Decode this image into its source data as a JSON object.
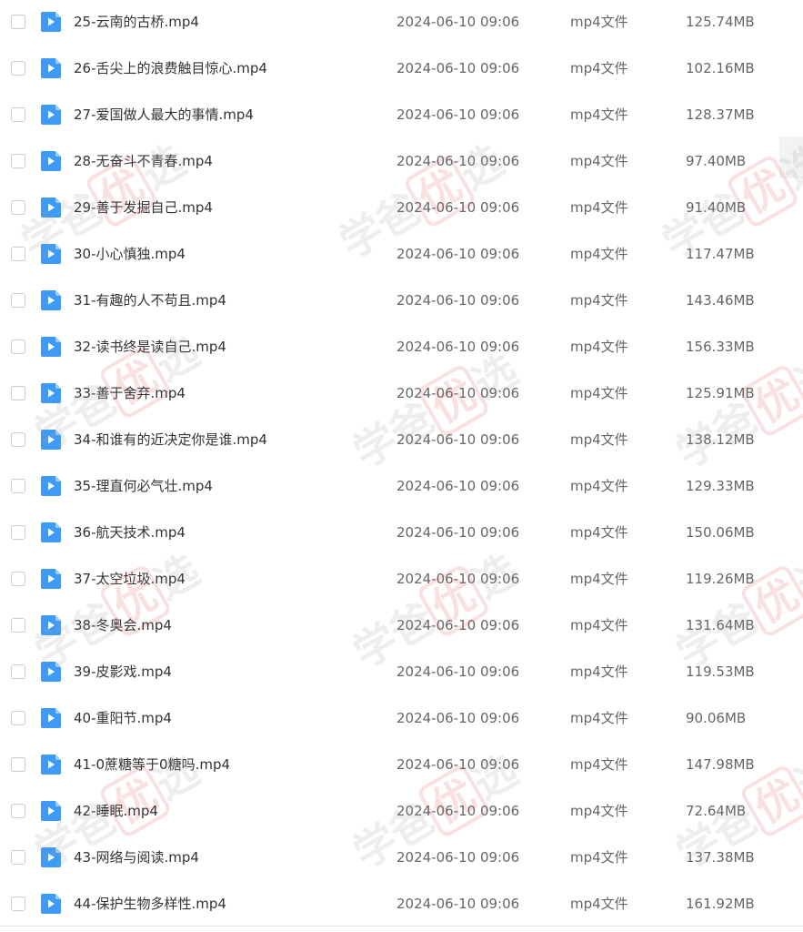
{
  "files": [
    {
      "name": "25-云南的古桥.mp4",
      "date": "2024-06-10 09:06",
      "type": "mp4文件",
      "size": "125.74MB"
    },
    {
      "name": "26-舌尖上的浪费触目惊心.mp4",
      "date": "2024-06-10 09:06",
      "type": "mp4文件",
      "size": "102.16MB"
    },
    {
      "name": "27-爱国做人最大的事情.mp4",
      "date": "2024-06-10 09:06",
      "type": "mp4文件",
      "size": "128.37MB"
    },
    {
      "name": "28-无奋斗不青春.mp4",
      "date": "2024-06-10 09:06",
      "type": "mp4文件",
      "size": "97.40MB"
    },
    {
      "name": "29-善于发掘自己.mp4",
      "date": "2024-06-10 09:06",
      "type": "mp4文件",
      "size": "91.40MB"
    },
    {
      "name": "30-小心慎独.mp4",
      "date": "2024-06-10 09:06",
      "type": "mp4文件",
      "size": "117.47MB"
    },
    {
      "name": "31-有趣的人不苟且.mp4",
      "date": "2024-06-10 09:06",
      "type": "mp4文件",
      "size": "143.46MB"
    },
    {
      "name": "32-读书终是读自己.mp4",
      "date": "2024-06-10 09:06",
      "type": "mp4文件",
      "size": "156.33MB"
    },
    {
      "name": "33-善于舍弃.mp4",
      "date": "2024-06-10 09:06",
      "type": "mp4文件",
      "size": "125.91MB"
    },
    {
      "name": "34-和谁有的近决定你是谁.mp4",
      "date": "2024-06-10 09:06",
      "type": "mp4文件",
      "size": "138.12MB"
    },
    {
      "name": "35-理直何必气壮.mp4",
      "date": "2024-06-10 09:06",
      "type": "mp4文件",
      "size": "129.33MB"
    },
    {
      "name": "36-航天技术.mp4",
      "date": "2024-06-10 09:06",
      "type": "mp4文件",
      "size": "150.06MB"
    },
    {
      "name": "37-太空垃圾.mp4",
      "date": "2024-06-10 09:06",
      "type": "mp4文件",
      "size": "119.26MB"
    },
    {
      "name": "38-冬奥会.mp4",
      "date": "2024-06-10 09:06",
      "type": "mp4文件",
      "size": "131.64MB"
    },
    {
      "name": "39-皮影戏.mp4",
      "date": "2024-06-10 09:06",
      "type": "mp4文件",
      "size": "119.53MB"
    },
    {
      "name": "40-重阳节.mp4",
      "date": "2024-06-10 09:06",
      "type": "mp4文件",
      "size": "90.06MB"
    },
    {
      "name": "41-0蔗糖等于0糖吗.mp4",
      "date": "2024-06-10 09:06",
      "type": "mp4文件",
      "size": "147.98MB"
    },
    {
      "name": "42-睡眠.mp4",
      "date": "2024-06-10 09:06",
      "type": "mp4文件",
      "size": "72.64MB"
    },
    {
      "name": "43-网络与阅读.mp4",
      "date": "2024-06-10 09:06",
      "type": "mp4文件",
      "size": "137.38MB"
    },
    {
      "name": "44-保护生物多样性.mp4",
      "date": "2024-06-10 09:06",
      "type": "mp4文件",
      "size": "161.92MB"
    }
  ],
  "watermark": {
    "part1": "学爸",
    "part2": "优",
    "part3": "选"
  },
  "icons": {
    "file": "video-file-icon",
    "select": "checkbox"
  },
  "colors": {
    "icon_blue": "#3d9bf5",
    "icon_fold": "#9ccbfa"
  }
}
